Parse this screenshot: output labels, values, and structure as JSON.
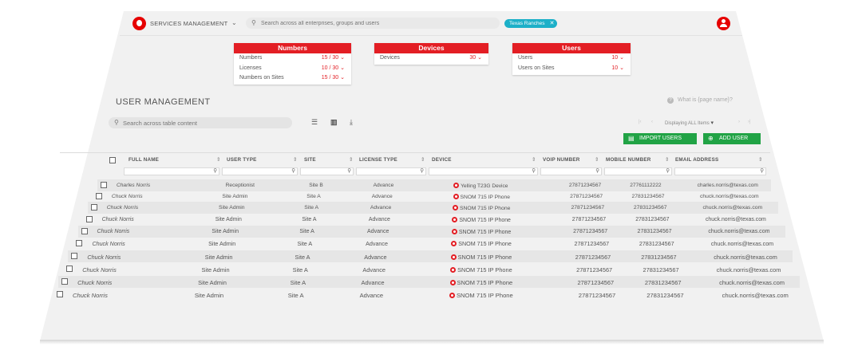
{
  "header": {
    "app_title": "SERVICES MANAGEMENT",
    "search_placeholder": "Search across all enterprises, groups and users",
    "filter_chip": "Texas Ranches"
  },
  "summary": {
    "numbers": {
      "title": "Numbers",
      "rows": [
        {
          "label": "Numbers",
          "value": "15 / 30"
        },
        {
          "label": "Licenses",
          "value": "10 / 30"
        },
        {
          "label": "Numbers on Sites",
          "value": "15 / 30"
        }
      ]
    },
    "devices": {
      "title": "Devices",
      "rows": [
        {
          "label": "Devices",
          "value": "30"
        }
      ]
    },
    "users": {
      "title": "Users",
      "rows": [
        {
          "label": "Users",
          "value": "10"
        },
        {
          "label": "Users on Sites",
          "value": "10"
        }
      ]
    }
  },
  "section": {
    "title": "USER MANAGEMENT",
    "help": "What is {page name}?"
  },
  "toolbar": {
    "search_placeholder": "Search across table content",
    "pager_text": "Displaying ALL Items",
    "import_label": "IMPORT USERS",
    "add_label": "ADD USER"
  },
  "table": {
    "columns": [
      "FULL NAME",
      "USER TYPE",
      "SITE",
      "LICENSE TYPE",
      "DEVICE",
      "VOIP NUMBER",
      "MOBILE NUMBER",
      "EMAIL ADDRESS"
    ],
    "rows": [
      {
        "name": "Charles Norris",
        "type": "Receptionist",
        "site": "Site B",
        "license": "Advance",
        "device": "Yelling T23G Device",
        "voip": "27871234567",
        "mobile": "27761112222",
        "email": "charles.norris@texas.com"
      },
      {
        "name": "Chuck  Norris",
        "type": "Site Admin",
        "site": "Site A",
        "license": "Advance",
        "device": "SNOM 715 IP Phone",
        "voip": "27871234567",
        "mobile": "27831234567",
        "email": "chuck.norris@texas.com"
      },
      {
        "name": "Chuck  Norris",
        "type": "Site Admin",
        "site": "Site A",
        "license": "Advance",
        "device": "SNOM 715 IP Phone",
        "voip": "27871234567",
        "mobile": "27831234567",
        "email": "chuck.norris@texas.com"
      },
      {
        "name": "Chuck  Norris",
        "type": "Site Admin",
        "site": "Site A",
        "license": "Advance",
        "device": "SNOM 715 IP Phone",
        "voip": "27871234567",
        "mobile": "27831234567",
        "email": "chuck.norris@texas.com"
      },
      {
        "name": "Chuck  Norris",
        "type": "Site Admin",
        "site": "Site A",
        "license": "Advance",
        "device": "SNOM 715 IP Phone",
        "voip": "27871234567",
        "mobile": "27831234567",
        "email": "chuck.norris@texas.com"
      },
      {
        "name": "Chuck  Norris",
        "type": "Site Admin",
        "site": "Site A",
        "license": "Advance",
        "device": "SNOM 715 IP Phone",
        "voip": "27871234567",
        "mobile": "27831234567",
        "email": "chuck.norris@texas.com"
      },
      {
        "name": "Chuck  Norris",
        "type": "Site Admin",
        "site": "Site A",
        "license": "Advance",
        "device": "SNOM 715 IP Phone",
        "voip": "27871234567",
        "mobile": "27831234567",
        "email": "chuck.norris@texas.com"
      },
      {
        "name": "Chuck  Norris",
        "type": "Site Admin",
        "site": "Site A",
        "license": "Advance",
        "device": "SNOM 715 IP Phone",
        "voip": "27871234567",
        "mobile": "27831234567",
        "email": "chuck.norris@texas.com"
      },
      {
        "name": "Chuck  Norris",
        "type": "Site Admin",
        "site": "Site A",
        "license": "Advance",
        "device": "SNOM 715 IP Phone",
        "voip": "27871234567",
        "mobile": "27831234567",
        "email": "chuck.norris@texas.com"
      },
      {
        "name": "Chuck  Norris",
        "type": "Site Admin",
        "site": "Site A",
        "license": "Advance",
        "device": "SNOM 715 IP Phone",
        "voip": "27871234567",
        "mobile": "27831234567",
        "email": "chuck.norris@texas.com"
      }
    ]
  },
  "colors": {
    "brand_red": "#e31e24",
    "action_green": "#21a345",
    "chip_teal": "#1cb0c8"
  }
}
